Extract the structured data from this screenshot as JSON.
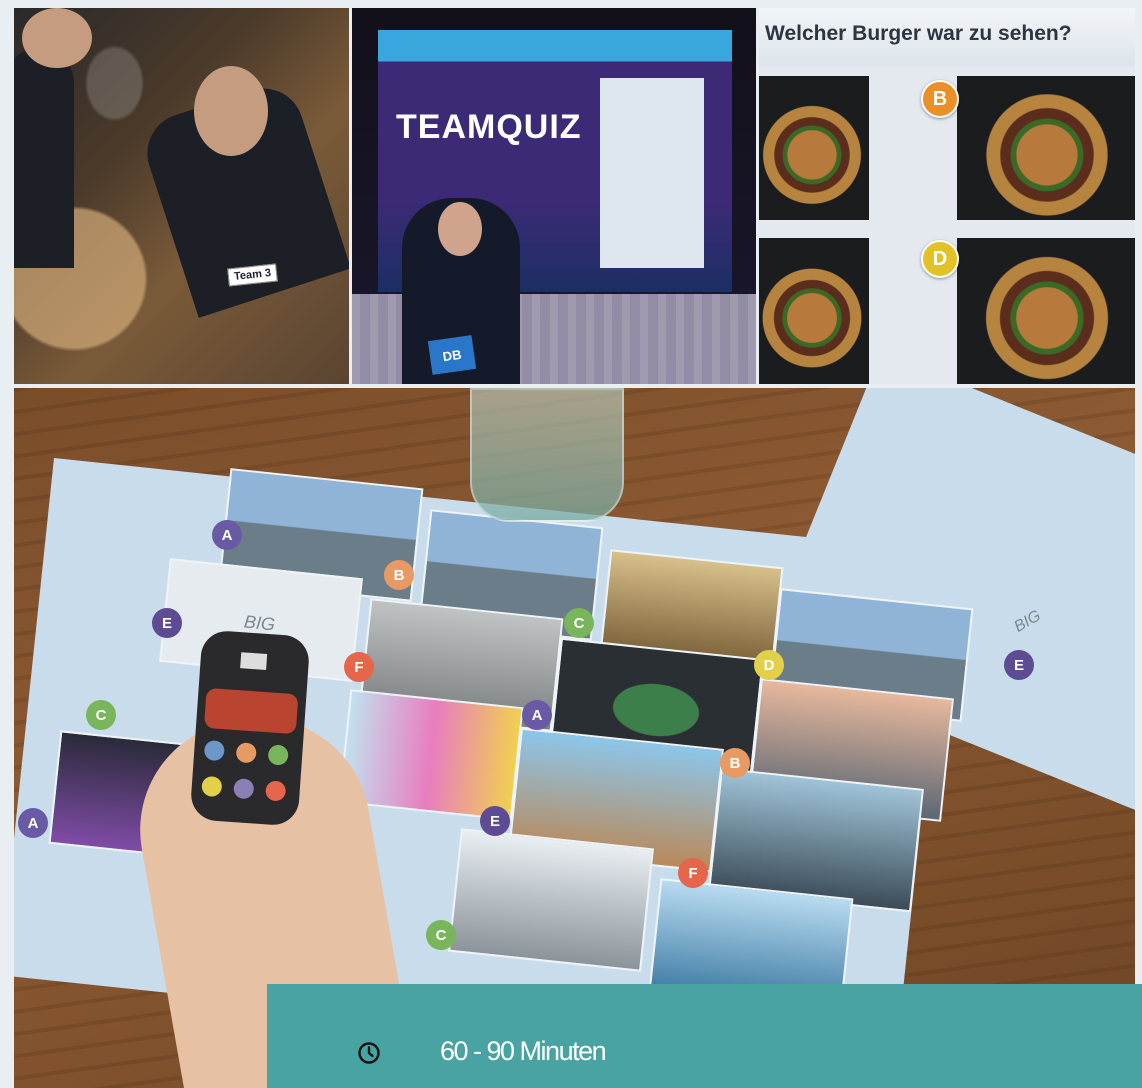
{
  "collage": {
    "team_photo": {
      "card_label": "Team 3"
    },
    "stage_photo": {
      "screen_title": "TEAMQUIZ",
      "badge": "DB"
    },
    "burger_quiz": {
      "question": "Welcher Burger war zu sehen?",
      "options": [
        "B",
        "D"
      ]
    },
    "board_photo": {
      "cards": [
        "BIG",
        "BIG"
      ],
      "markers": [
        "A",
        "B",
        "C",
        "E",
        "F",
        "A",
        "B",
        "C",
        "D",
        "E",
        "F",
        "A",
        "C",
        "E"
      ]
    }
  },
  "info": {
    "icon": "clock-icon",
    "duration": "60 - 90 Minuten"
  },
  "colors": {
    "info_background": "#4aa3a3",
    "marker_A": "#6a5aa6",
    "marker_B": "#e79a63",
    "marker_C": "#79b55b",
    "marker_D": "#e2d04a",
    "marker_E": "#5d4b94",
    "marker_F": "#e5664a",
    "option_B": "#e9902a",
    "option_D": "#e2c228"
  }
}
